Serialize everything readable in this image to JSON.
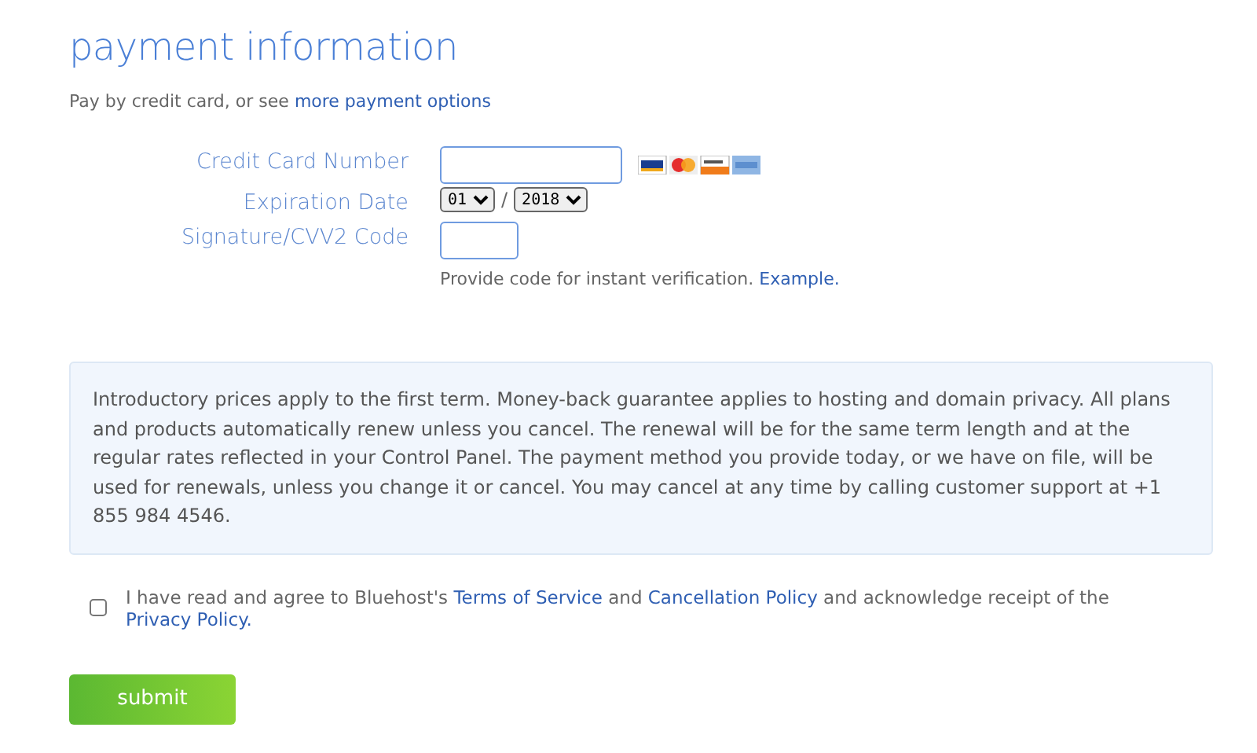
{
  "title": "payment information",
  "intro": [
    {
      "kind": "text",
      "text": "Pay by credit card, or see "
    },
    {
      "kind": "link",
      "text": "more payment options"
    }
  ],
  "form": {
    "card_number": {
      "label": "Credit Card Number"
    },
    "expiration": {
      "label": "Expiration Date",
      "month": "01",
      "separator": "/",
      "year": "2018"
    },
    "cvv": {
      "label": "Signature/CVV2 Code",
      "help": [
        {
          "kind": "text",
          "text": "Provide code for instant verification. "
        },
        {
          "kind": "link",
          "text": "Example."
        }
      ]
    }
  },
  "notice": "Introductory prices apply to the first term. Money-back guarantee applies to hosting and domain privacy. All plans and products automatically renew unless you cancel. The renewal will be for the same term length and at the regular rates reflected in your Control Panel. The payment method you provide today, or we have on file, will be used for renewals, unless you change it or cancel. You may cancel at any time by calling customer support at +1 855 984 4546.",
  "agreement": {
    "checked": false,
    "parts": [
      {
        "kind": "text",
        "text": "I have read and agree to Bluehost's "
      },
      {
        "kind": "link",
        "text": "Terms of Service"
      },
      {
        "kind": "text",
        "text": " and "
      },
      {
        "kind": "link",
        "text": "Cancellation Policy"
      },
      {
        "kind": "text",
        "text": " and acknowledge receipt of the "
      },
      {
        "kind": "link",
        "text": "Privacy Policy."
      }
    ]
  },
  "submit": "submit"
}
